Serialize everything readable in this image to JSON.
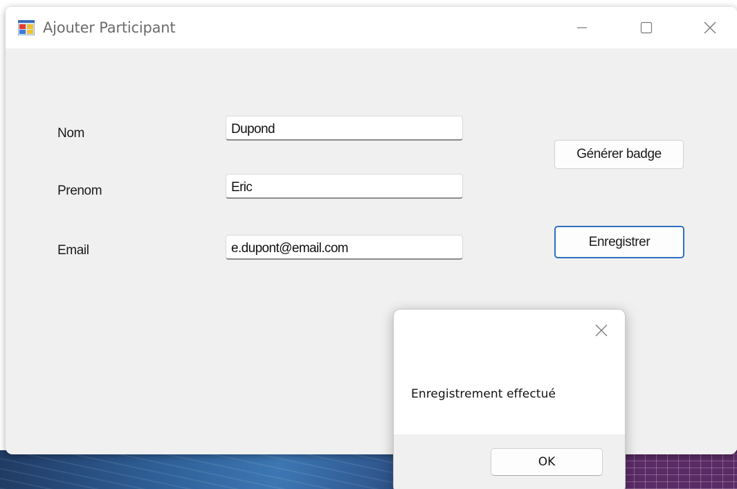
{
  "window": {
    "title": "Ajouter Participant",
    "icon": "winforms-app-icon"
  },
  "titlebar_controls": {
    "minimize": "minimize-icon",
    "maximize": "maximize-icon",
    "close": "close-icon"
  },
  "form": {
    "nom_label": "Nom",
    "nom_value": "Dupond",
    "prenom_label": "Prenom",
    "prenom_value": "Eric",
    "email_label": "Email",
    "email_value": "e.dupont@email.com"
  },
  "buttons": {
    "generer_badge": "Générer badge",
    "enregistrer": "Enregistrer"
  },
  "message_box": {
    "text": "Enregistrement effectué",
    "ok_label": "OK",
    "close_icon": "close-icon"
  },
  "colors": {
    "window_bg": "#f0f0f0",
    "accent": "#2d6fc2"
  }
}
